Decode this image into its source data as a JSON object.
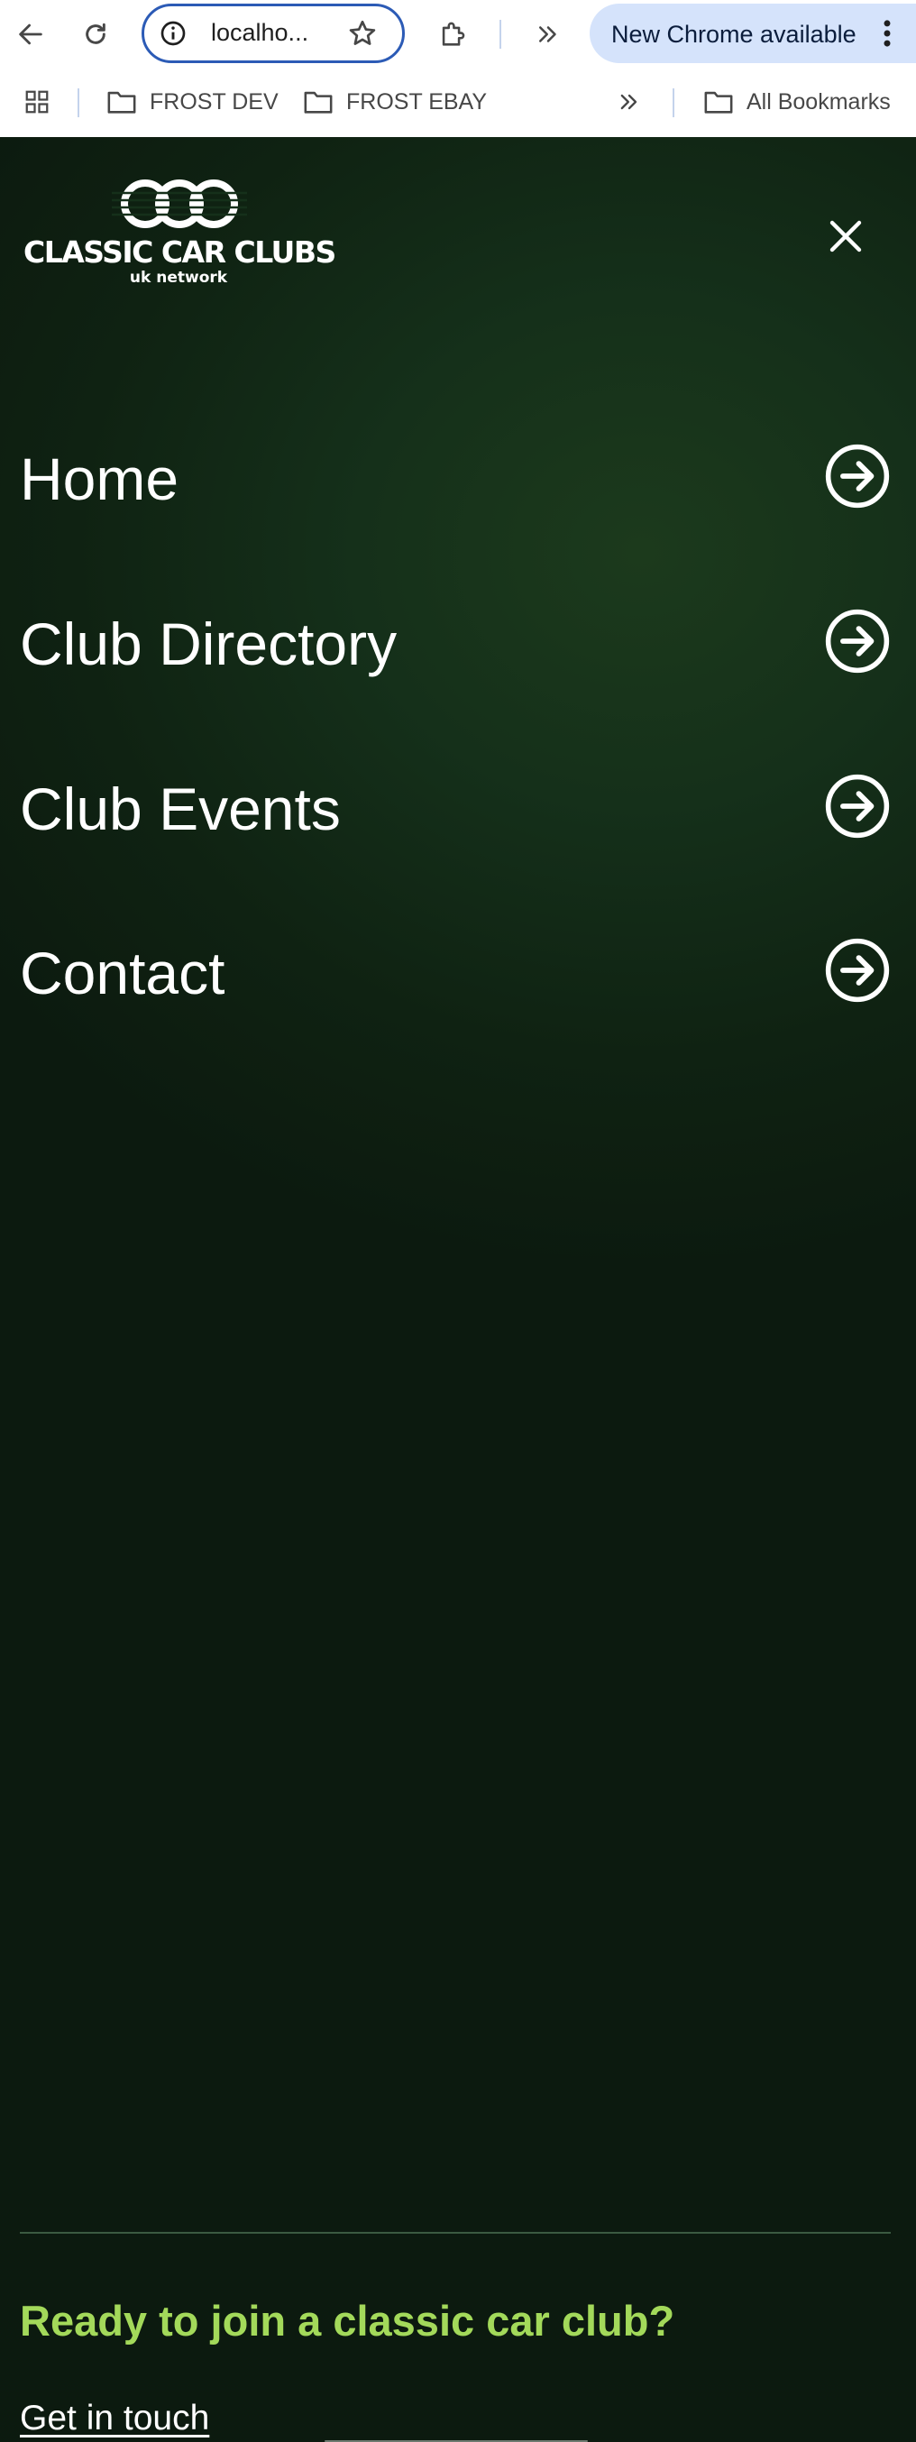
{
  "browser": {
    "url_display": "localho...",
    "update_button": "New Chrome available"
  },
  "bookmarks": {
    "items": [
      {
        "label": "FROST DEV"
      },
      {
        "label": "FROST EBAY"
      }
    ],
    "all_bookmarks": "All Bookmarks"
  },
  "site": {
    "logo": {
      "name": "CLASSIC CAR CLUBS",
      "tagline": "uk network"
    },
    "nav": [
      {
        "label": "Home"
      },
      {
        "label": "Club Directory"
      },
      {
        "label": "Club Events"
      },
      {
        "label": "Contact"
      }
    ],
    "cta": {
      "title": "Ready to join a classic car club?",
      "link": "Get in touch"
    },
    "colors": {
      "background": "#15301a",
      "accent": "#a3d95a",
      "text": "#ffffff"
    }
  }
}
